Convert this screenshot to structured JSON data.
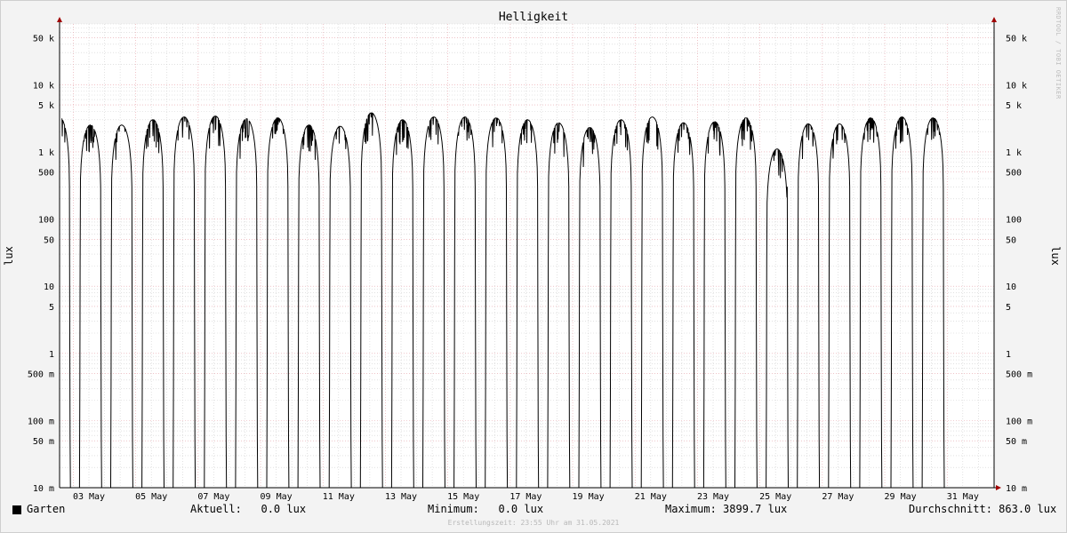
{
  "chart_data": {
    "type": "line",
    "title": "Helligkeit",
    "ylabel": "lux",
    "yscale": "log",
    "ylim": [
      0.01,
      80000
    ],
    "y_ticks": [
      {
        "v": 0.01,
        "label": "10 m"
      },
      {
        "v": 0.05,
        "label": "50 m"
      },
      {
        "v": 0.1,
        "label": "100 m"
      },
      {
        "v": 0.5,
        "label": "500 m"
      },
      {
        "v": 1,
        "label": "1"
      },
      {
        "v": 5,
        "label": "5"
      },
      {
        "v": 10,
        "label": "10"
      },
      {
        "v": 50,
        "label": "50"
      },
      {
        "v": 100,
        "label": "100"
      },
      {
        "v": 500,
        "label": "500"
      },
      {
        "v": 1000,
        "label": "1 k"
      },
      {
        "v": 5000,
        "label": "5 k"
      },
      {
        "v": 10000,
        "label": "10 k"
      },
      {
        "v": 50000,
        "label": "50 k"
      }
    ],
    "x_ticks": [
      {
        "day": 3,
        "label": "03 May"
      },
      {
        "day": 5,
        "label": "05 May"
      },
      {
        "day": 7,
        "label": "07 May"
      },
      {
        "day": 9,
        "label": "09 May"
      },
      {
        "day": 11,
        "label": "11 May"
      },
      {
        "day": 13,
        "label": "13 May"
      },
      {
        "day": 15,
        "label": "15 May"
      },
      {
        "day": 17,
        "label": "17 May"
      },
      {
        "day": 19,
        "label": "19 May"
      },
      {
        "day": 21,
        "label": "21 May"
      },
      {
        "day": 23,
        "label": "23 May"
      },
      {
        "day": 25,
        "label": "25 May"
      },
      {
        "day": 27,
        "label": "27 May"
      },
      {
        "day": 29,
        "label": "29 May"
      },
      {
        "day": 31,
        "label": "31 May"
      }
    ],
    "grid": true,
    "series": [
      {
        "name": "Garten",
        "color": "#000000",
        "daily_peak_lux": [
          2600,
          3300,
          2500,
          2500,
          3000,
          3300,
          3400,
          3100,
          3200,
          2500,
          2400,
          3800,
          3000,
          3300,
          3300,
          3200,
          3000,
          2700,
          2300,
          3000,
          3300,
          2700,
          2800,
          3200,
          1100,
          2600,
          2600,
          3200,
          3300,
          3200
        ]
      }
    ]
  },
  "legend": {
    "series_name": "Garten",
    "current": "Aktuell:   0.0 lux",
    "minimum": "Minimum:   0.0 lux",
    "maximum": "Maximum: 3899.7 lux",
    "average": "Durchschnitt: 863.0 lux"
  },
  "watermark": "RRDTOOL / TOBI OETIKER",
  "footer": "Erstellungszeit: 23:55 Uhr am 31.05.2021"
}
